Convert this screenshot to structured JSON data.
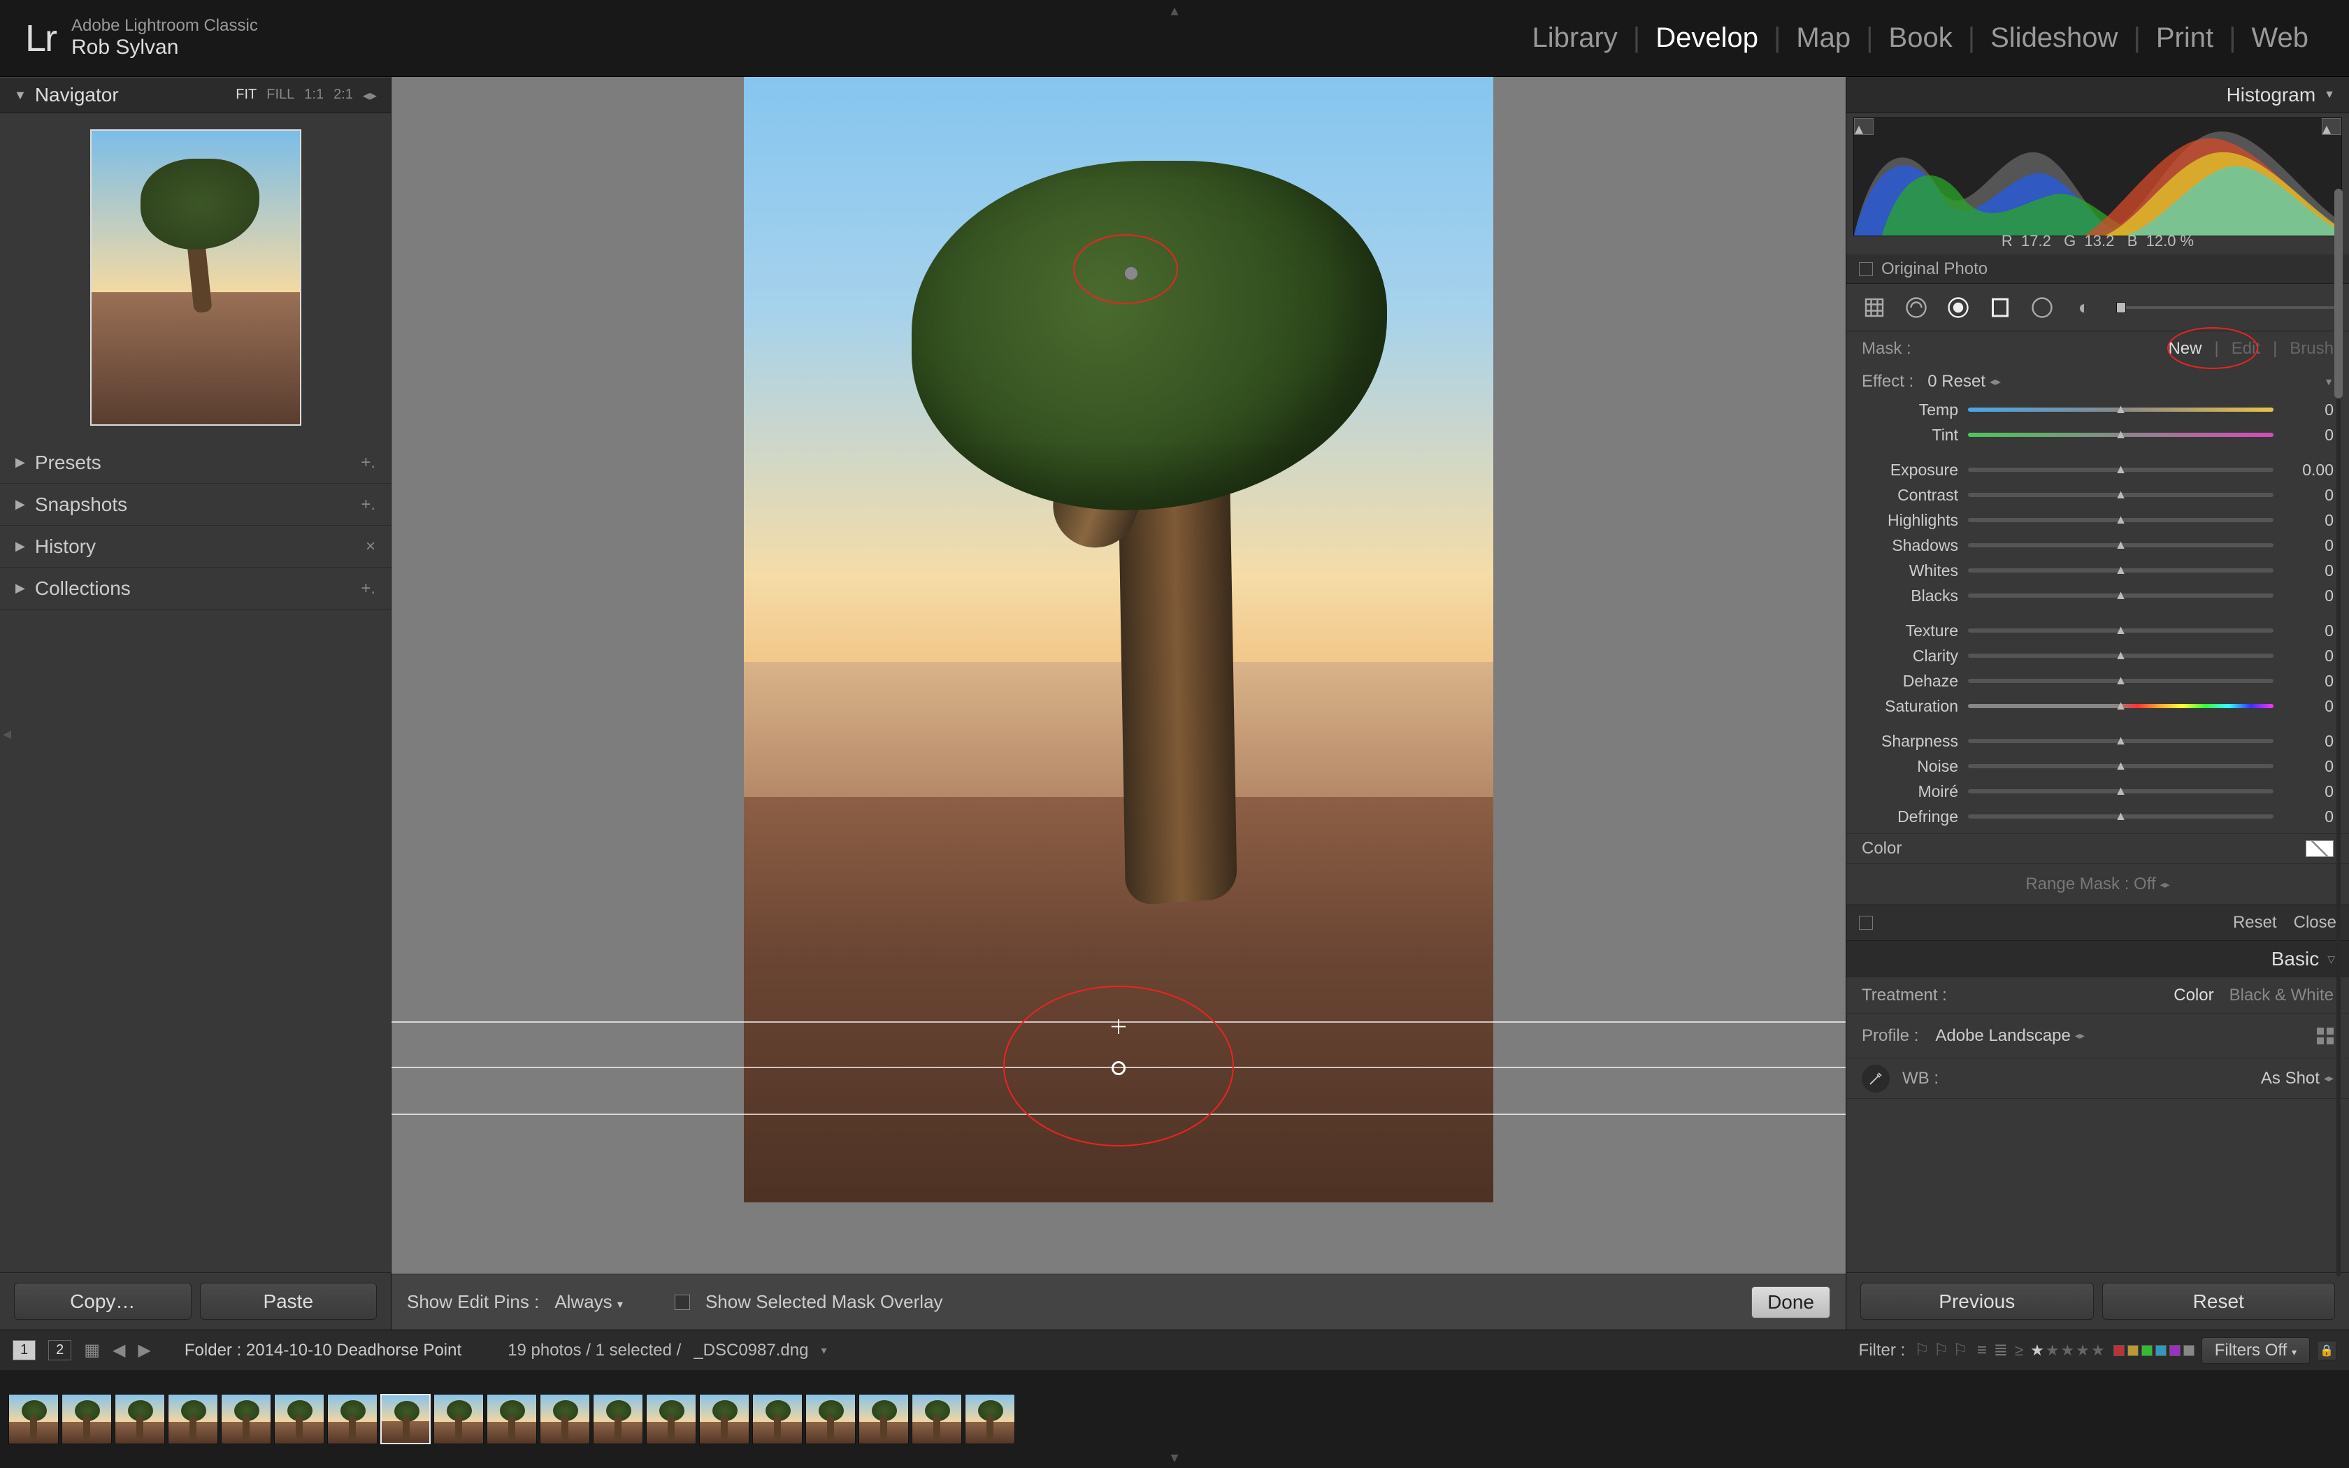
{
  "app": {
    "name": "Adobe Lightroom Classic",
    "user": "Rob Sylvan",
    "logo": "Lr"
  },
  "modules": [
    "Library",
    "Develop",
    "Map",
    "Book",
    "Slideshow",
    "Print",
    "Web"
  ],
  "active_module": "Develop",
  "left": {
    "navigator": {
      "title": "Navigator",
      "fit": "FIT",
      "fill": "FILL",
      "ratio1": "1:1",
      "ratio2": "2:1"
    },
    "panels": {
      "presets": {
        "label": "Presets",
        "after": "+."
      },
      "snapshots": {
        "label": "Snapshots",
        "after": "+."
      },
      "history": {
        "label": "History",
        "after": "×"
      },
      "collections": {
        "label": "Collections",
        "after": "+."
      }
    },
    "copy": "Copy…",
    "paste": "Paste"
  },
  "toolbar": {
    "edit_pins_label": "Show Edit Pins :",
    "edit_pins_value": "Always",
    "overlay_label": "Show Selected Mask Overlay",
    "done": "Done"
  },
  "right": {
    "histogram": {
      "title": "Histogram",
      "readout_r": "R",
      "readout_r_val": "17.2",
      "readout_g": "G",
      "readout_g_val": "13.2",
      "readout_b": "B",
      "readout_b_val": "12.0 %"
    },
    "original_photo": "Original Photo",
    "mask_label": "Mask :",
    "mask_tabs": {
      "new": "New",
      "edit": "Edit",
      "brush": "Brush"
    },
    "effect_label": "Effect :",
    "effect_value": "0 Reset",
    "sliders": [
      {
        "k": "temp",
        "label": "Temp",
        "value": "0",
        "track": "temp"
      },
      {
        "k": "tint",
        "label": "Tint",
        "value": "0",
        "track": "tint"
      },
      {
        "k": "gap"
      },
      {
        "k": "exposure",
        "label": "Exposure",
        "value": "0.00",
        "track": ""
      },
      {
        "k": "contrast",
        "label": "Contrast",
        "value": "0",
        "track": ""
      },
      {
        "k": "highlights",
        "label": "Highlights",
        "value": "0",
        "track": ""
      },
      {
        "k": "shadows",
        "label": "Shadows",
        "value": "0",
        "track": ""
      },
      {
        "k": "whites",
        "label": "Whites",
        "value": "0",
        "track": ""
      },
      {
        "k": "blacks",
        "label": "Blacks",
        "value": "0",
        "track": ""
      },
      {
        "k": "gap"
      },
      {
        "k": "texture",
        "label": "Texture",
        "value": "0",
        "track": ""
      },
      {
        "k": "clarity",
        "label": "Clarity",
        "value": "0",
        "track": ""
      },
      {
        "k": "dehaze",
        "label": "Dehaze",
        "value": "0",
        "track": ""
      },
      {
        "k": "saturation",
        "label": "Saturation",
        "value": "0",
        "track": "sat"
      },
      {
        "k": "gap"
      },
      {
        "k": "sharpness",
        "label": "Sharpness",
        "value": "0",
        "track": ""
      },
      {
        "k": "noise",
        "label": "Noise",
        "value": "0",
        "track": ""
      },
      {
        "k": "moire",
        "label": "Moiré",
        "value": "0",
        "track": ""
      },
      {
        "k": "defringe",
        "label": "Defringe",
        "value": "0",
        "track": ""
      }
    ],
    "color_label": "Color",
    "range_mask": "Range Mask : Off",
    "reset": "Reset",
    "close": "Close",
    "basic": {
      "title": "Basic",
      "treatment_label": "Treatment :",
      "color": "Color",
      "bw": "Black & White",
      "profile_label": "Profile :",
      "profile_value": "Adobe Landscape",
      "wb_label": "WB :",
      "wb_value": "As Shot"
    },
    "previous": "Previous",
    "reset2": "Reset"
  },
  "footer": {
    "page1": "1",
    "page2": "2",
    "path_label": "Folder :",
    "path_value": "2014-10-10 Deadhorse Point",
    "count": "19 photos / 1 selected /",
    "file": "_DSC0987.dng",
    "filter_label": "Filter :",
    "filters_off": "Filters Off",
    "thumbs": 19,
    "selected_index": 7,
    "rating_min_prefix": "≥",
    "rating_stars": 1,
    "label_colors": [
      "#b33",
      "#b93",
      "#3b3",
      "#39b",
      "#93b",
      "#888"
    ]
  }
}
